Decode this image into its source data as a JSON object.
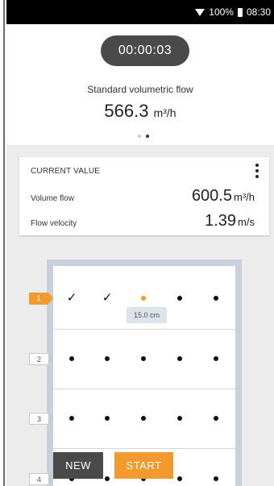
{
  "status": {
    "battery": "100%",
    "time": "08:30",
    "icons": [
      "wifi-icon",
      "battery-icon"
    ]
  },
  "timer": "00:00:03",
  "measurement": {
    "label": "Standard volumetric flow",
    "value": "566.3",
    "unit": "m³/h"
  },
  "pager": {
    "pages": 2,
    "active": 2
  },
  "card": {
    "title": "CURRENT VALUE",
    "rows": [
      {
        "label": "Volume flow",
        "value": "600.5",
        "unit": "m³/h"
      },
      {
        "label": "Flow velocity",
        "value": "1.39",
        "unit": "m/s"
      }
    ]
  },
  "traverse": {
    "rows": [
      {
        "label": "1",
        "points": [
          "done",
          "done",
          "current",
          "pending",
          "pending"
        ]
      },
      {
        "label": "2",
        "points": [
          "pending",
          "pending",
          "pending",
          "pending",
          "pending"
        ]
      },
      {
        "label": "3",
        "points": [
          "pending",
          "pending",
          "pending",
          "pending",
          "pending"
        ]
      },
      {
        "label": "4",
        "points": [
          "pending",
          "pending",
          "pending",
          "pending",
          "pending"
        ]
      }
    ],
    "active_row": 1,
    "current_depth": "15.0 cm"
  },
  "buttons": {
    "new": "NEW",
    "start": "START"
  },
  "colors": {
    "accent": "#f29a2e",
    "dark": "#4a4a4a",
    "duct": "#c7d0db"
  }
}
